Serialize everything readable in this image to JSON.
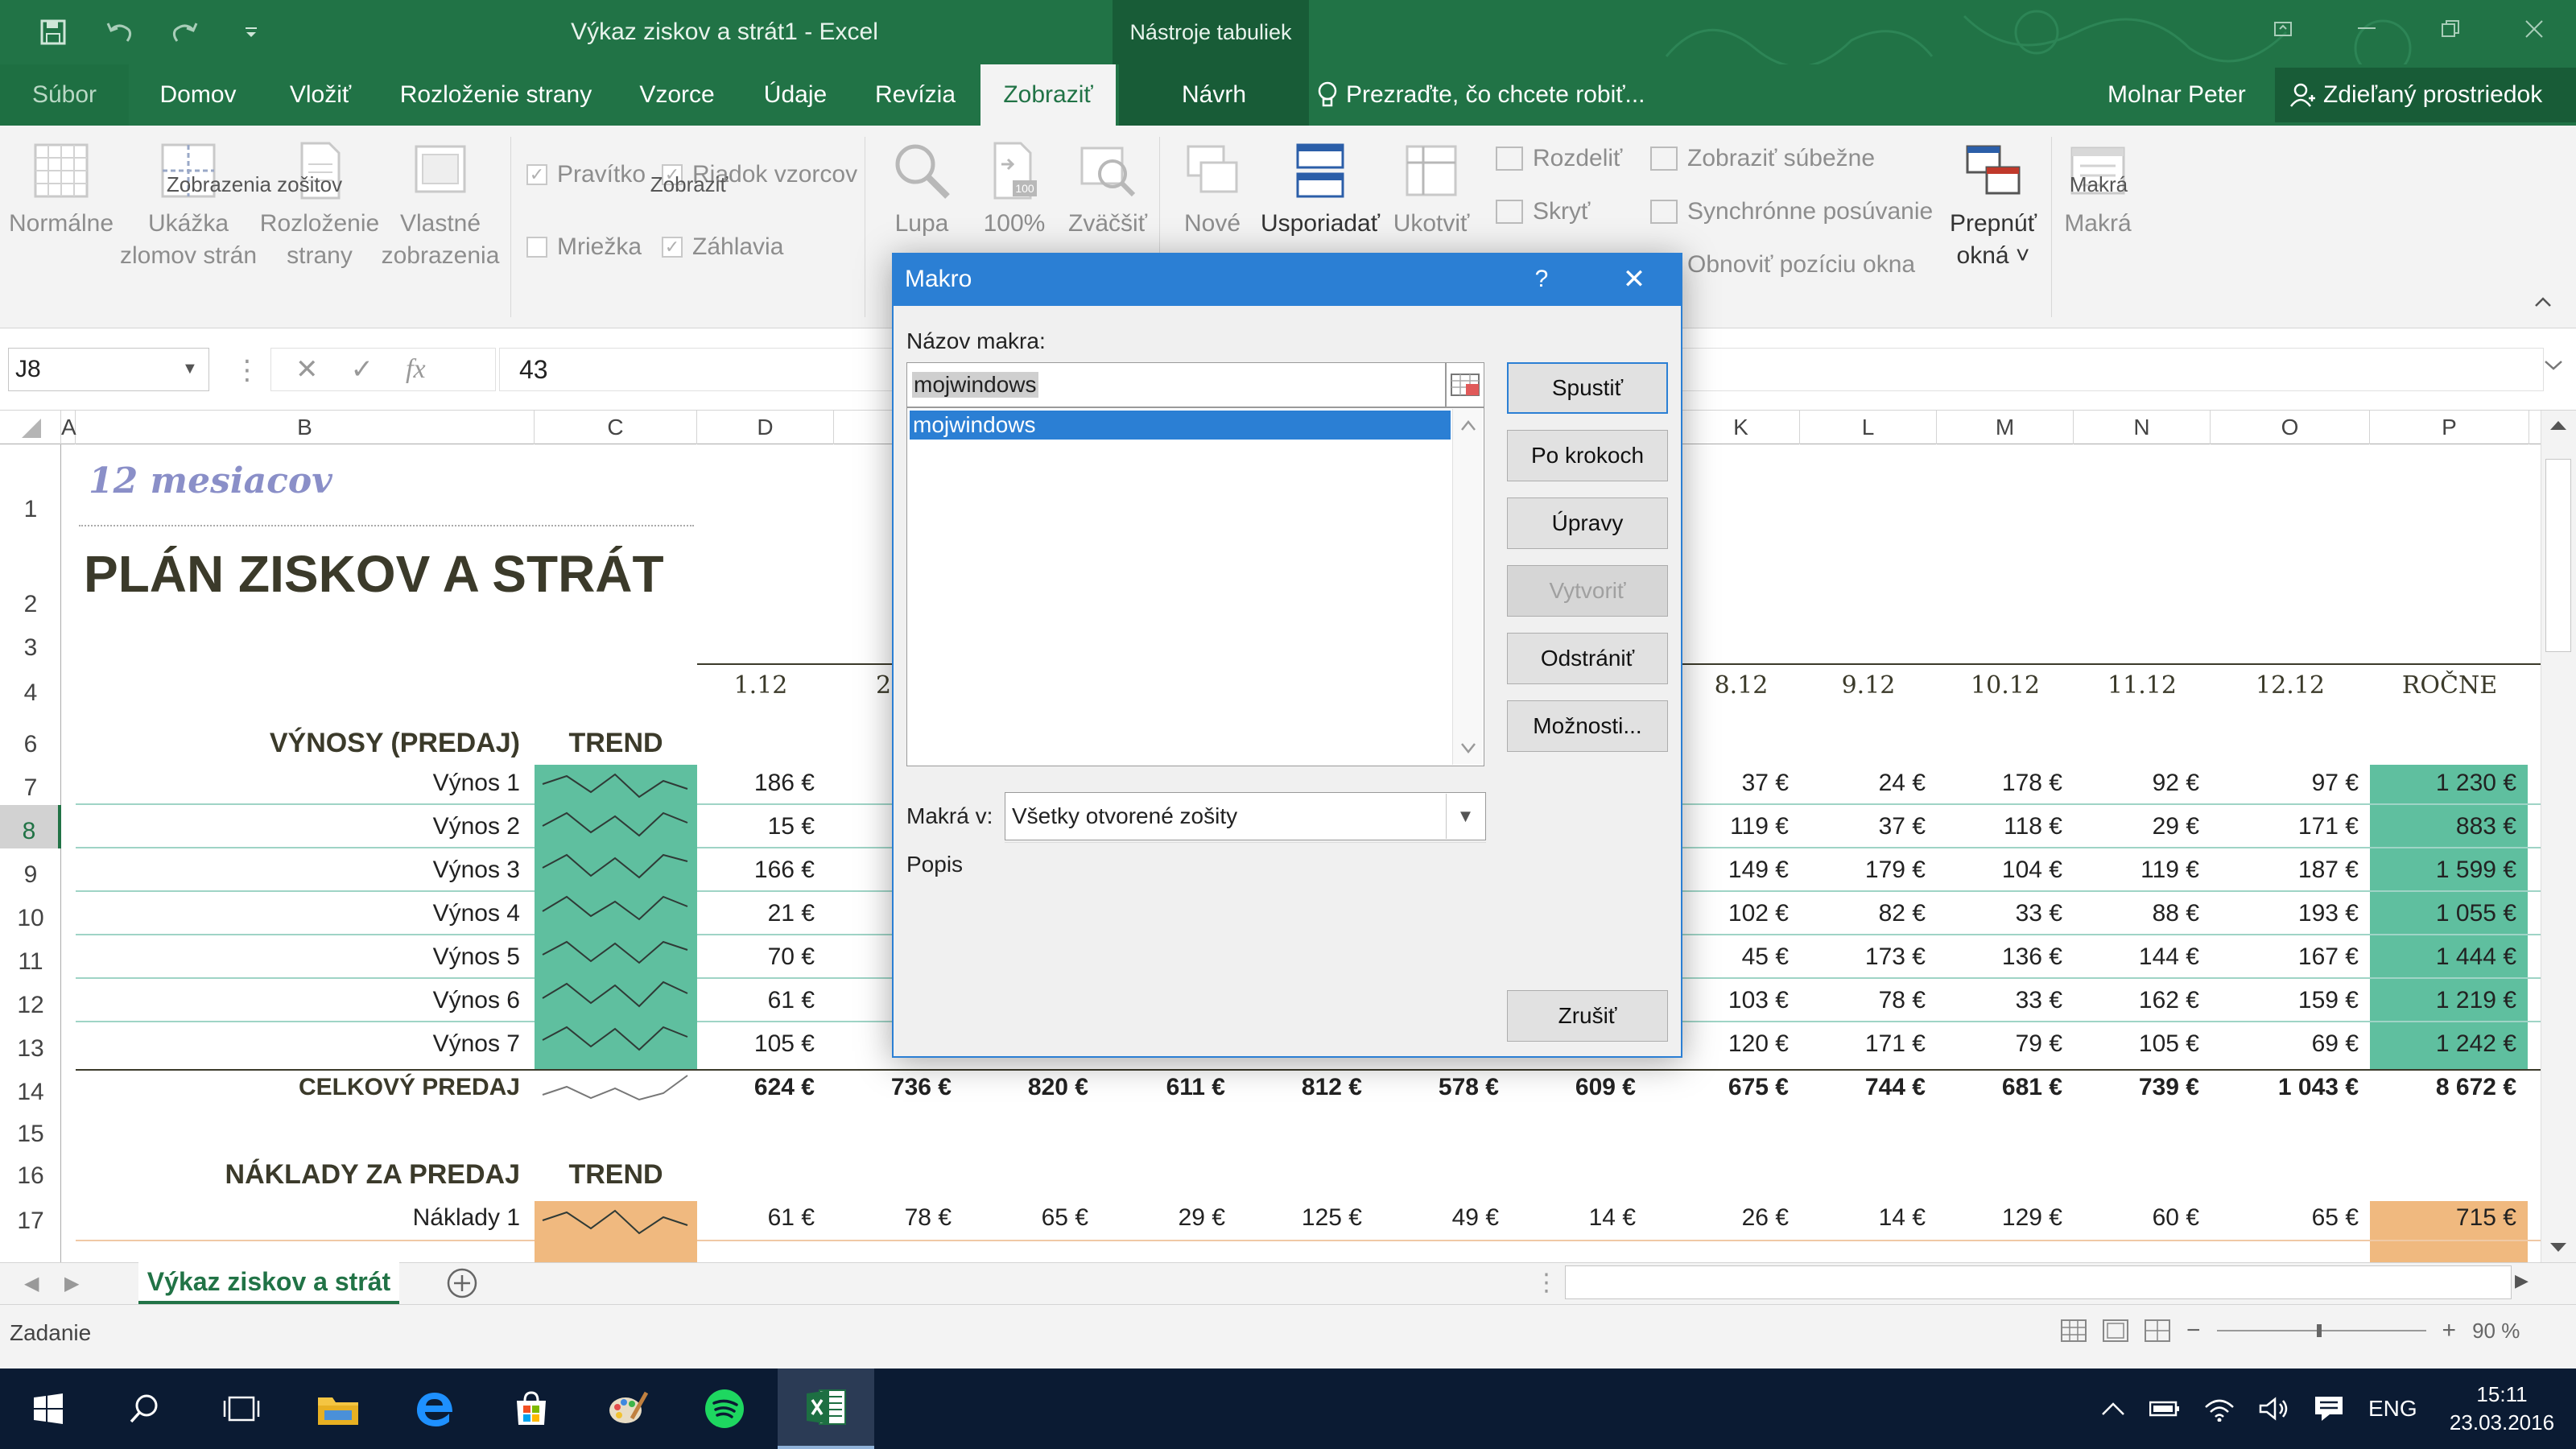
{
  "window": {
    "title": "Výkaz ziskov a strát1 - Excel",
    "context_tab_group": "Nástroje tabuliek",
    "accent_color": "#217346"
  },
  "tabs": [
    {
      "label": "Súbor"
    },
    {
      "label": "Domov"
    },
    {
      "label": "Vložiť"
    },
    {
      "label": "Rozloženie strany"
    },
    {
      "label": "Vzorce"
    },
    {
      "label": "Údaje"
    },
    {
      "label": "Revízia"
    },
    {
      "label": "Zobraziť",
      "active": true
    },
    {
      "label": "Návrh"
    }
  ],
  "tell_me": "Prezraďte, čo chcete robiť...",
  "user": "Molnar Peter",
  "share": "Zdieľaný prostriedok",
  "ribbon": {
    "views": {
      "normal": "Normálne",
      "page_break_1": "Ukážka",
      "page_break_2": "zlomov strán",
      "page_layout_1": "Rozloženie",
      "page_layout_2": "strany",
      "custom_1": "Vlastné",
      "custom_2": "zobrazenia",
      "group": "Zobrazenia zošitov"
    },
    "show": {
      "ruler": "Pravítko",
      "formula_bar": "Riadok vzorcov",
      "gridlines": "Mriežka",
      "headings": "Záhlavia",
      "group": "Zobraziť"
    },
    "zoom": {
      "zoom": "Lupa",
      "hundred": "100%",
      "zoom_selection": "Zväčšiť",
      "icon_text": "100"
    },
    "window": {
      "new": "Nové",
      "arrange": "Usporiadať",
      "freeze": "Ukotviť",
      "split": "Rozdeliť",
      "hide": "Skryť",
      "side_by_side": "Zobraziť súbežne",
      "sync_scroll": "Synchrónne posúvanie",
      "reset_pos": "Obnoviť pozíciu okna",
      "switch_1": "Prepnúť",
      "switch_2": "okná ˅"
    },
    "macros": {
      "macros": "Makrá",
      "group": "Makrá"
    }
  },
  "formula_bar": {
    "name_box": "J8",
    "cancel": "✕",
    "enter": "✓",
    "fx": "fx",
    "value": "43"
  },
  "columns": [
    "A",
    "B",
    "C",
    "D",
    "",
    "K",
    "L",
    "M",
    "N",
    "O",
    "P"
  ],
  "rows": [
    "1",
    "2",
    "3",
    "4",
    "",
    "6",
    "7",
    "8",
    "9",
    "10",
    "11",
    "12",
    "13",
    "14",
    "15",
    "16",
    "17"
  ],
  "sheet": {
    "subtitle": "12 mesiacov",
    "title": "PLÁN ZISKOV A STRÁT",
    "month_headers": [
      "1.12",
      "2",
      "8.12",
      "9.12",
      "10.12",
      "11.12",
      "12.12",
      "ROČNE"
    ],
    "revenue_header": "VÝNOSY (PREDAJ)",
    "trend_label": "TREND",
    "revenue_rows": [
      {
        "label": "Výnos 1",
        "d": "186 €",
        "k": "37 €",
        "l": "24 €",
        "m": "178 €",
        "n": "92 €",
        "o": "97 €",
        "p": "1 230 €"
      },
      {
        "label": "Výnos 2",
        "d": "15 €",
        "k": "119 €",
        "l": "37 €",
        "m": "118 €",
        "n": "29 €",
        "o": "171 €",
        "p": "883 €"
      },
      {
        "label": "Výnos 3",
        "d": "166 €",
        "k": "149 €",
        "l": "179 €",
        "m": "104 €",
        "n": "119 €",
        "o": "187 €",
        "p": "1 599 €"
      },
      {
        "label": "Výnos 4",
        "d": "21 €",
        "k": "102 €",
        "l": "82 €",
        "m": "33 €",
        "n": "88 €",
        "o": "193 €",
        "p": "1 055 €"
      },
      {
        "label": "Výnos 5",
        "d": "70 €",
        "k": "45 €",
        "l": "173 €",
        "m": "136 €",
        "n": "144 €",
        "o": "167 €",
        "p": "1 444 €"
      },
      {
        "label": "Výnos 6",
        "d": "61 €",
        "k": "103 €",
        "l": "78 €",
        "m": "33 €",
        "n": "162 €",
        "o": "159 €",
        "p": "1 219 €"
      },
      {
        "label": "Výnos 7",
        "d": "105 €",
        "k": "120 €",
        "l": "171 €",
        "m": "79 €",
        "n": "105 €",
        "o": "69 €",
        "p": "1 242 €"
      }
    ],
    "total_label": "CELKOVÝ PREDAJ",
    "total_values": [
      "624 €",
      "736 €",
      "820 €",
      "611 €",
      "812 €",
      "578 €",
      "609 €",
      "675 €",
      "744 €",
      "681 €",
      "739 €",
      "1 043 €",
      "8 672 €"
    ],
    "cost_header": "NÁKLADY ZA PREDAJ",
    "cost_trend_label": "TREND",
    "cost_row": {
      "label": "Náklady 1",
      "values": [
        "61 €",
        "78 €",
        "65 €",
        "29 €",
        "125 €",
        "49 €",
        "14 €",
        "26 €",
        "14 €",
        "129 €",
        "60 €",
        "65 €",
        "715 €"
      ]
    },
    "teal": "#5fbf9f",
    "peach": "#f0b97f"
  },
  "sheet_tab": "Výkaz ziskov a strát",
  "status": {
    "mode": "Zadanie",
    "zoom": "90 %"
  },
  "taskbar": {
    "lang": "ENG",
    "time": "15:11",
    "date": "23.03.2016"
  },
  "dialog": {
    "title": "Makro",
    "help": "?",
    "close": "✕",
    "name_label": "Názov makra:",
    "name_value": "mojwindows",
    "list": [
      "mojwindows"
    ],
    "macros_in_label": "Makrá v:",
    "macros_in_value": "Všetky otvorené zošity",
    "description_label": "Popis",
    "buttons": {
      "run": "Spustiť",
      "step": "Po krokoch",
      "edit": "Úpravy",
      "create": "Vytvoriť",
      "delete": "Odstrániť",
      "options": "Možnosti...",
      "cancel": "Zrušiť"
    }
  }
}
